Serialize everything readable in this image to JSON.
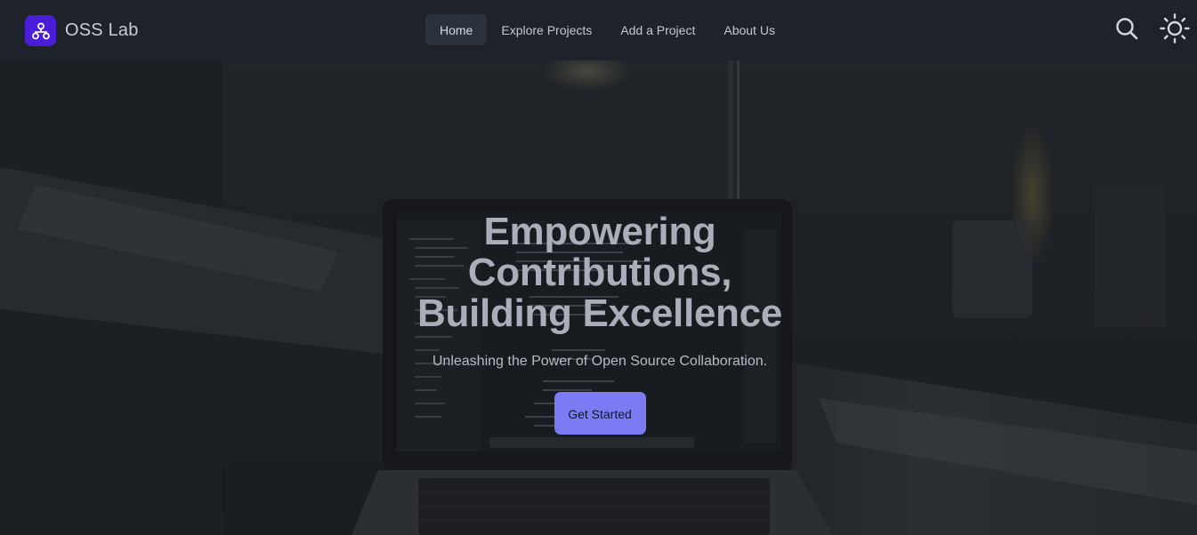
{
  "brand": {
    "name": "OSS Lab",
    "logo_icon": "network-nodes-icon",
    "logo_color": "#4a1dd8"
  },
  "nav": {
    "items": [
      {
        "label": "Home",
        "active": true
      },
      {
        "label": "Explore Projects",
        "active": false
      },
      {
        "label": "Add a Project",
        "active": false
      },
      {
        "label": "About Us",
        "active": false
      }
    ],
    "search_icon": "search-icon",
    "theme_icon": "sun-icon"
  },
  "hero": {
    "title_lines": [
      "Empowering",
      "Contributions,",
      "Building Excellence"
    ],
    "subtitle": "Unleashing the Power of Open Source Collaboration.",
    "cta_label": "Get Started",
    "background_image": "laptop-code-editor-photo",
    "cta_color": "#7b7cf4"
  },
  "colors": {
    "navbar_bg": "#1e232b",
    "nav_active_bg": "#2c323b",
    "text": "#c3c8d0"
  }
}
